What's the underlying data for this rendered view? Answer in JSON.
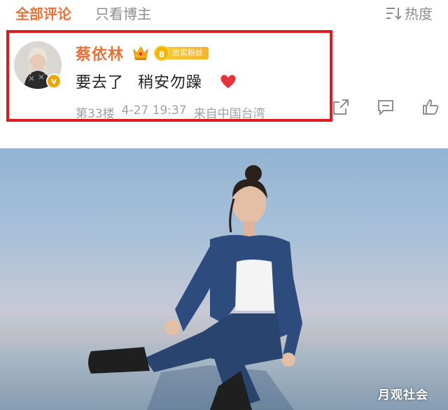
{
  "tabs": {
    "all_comments": "全部评论",
    "only_host": "只看博主",
    "sort_label": "热度"
  },
  "comment": {
    "username": "蔡依林",
    "fan_badge_level": "8",
    "fan_badge_text": "忠实粉丝",
    "verified_mark": "v",
    "text_part1": "要去了",
    "text_part2": "稍安勿躁",
    "floor": "第33楼",
    "time": "4-27 19:37",
    "location": "来自中国台湾"
  },
  "colors": {
    "accent": "#e8733a",
    "highlight_border": "#e0191e",
    "meta_gray": "#a0a0a0",
    "heart": "#e8323c",
    "badge_gold": "#f4b400"
  },
  "icons": [
    "sort-icon",
    "crown-icon",
    "heart-icon",
    "share-icon",
    "reply-icon",
    "like-icon",
    "verified-icon"
  ],
  "watermark": "月观社会"
}
